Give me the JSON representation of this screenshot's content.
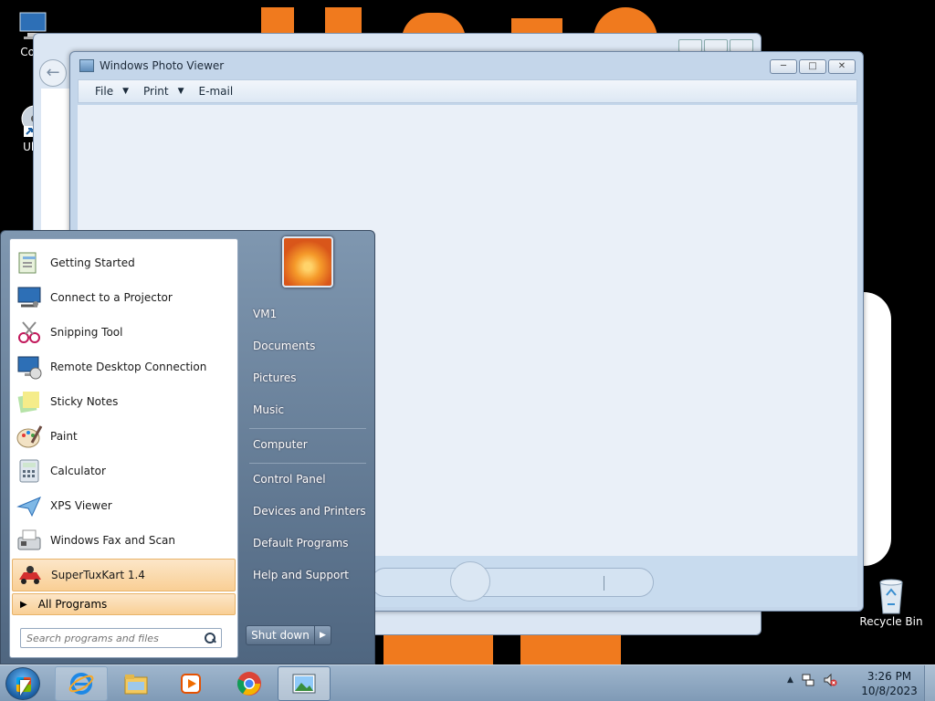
{
  "desktop": {
    "icons": [
      {
        "label": "Com",
        "icon": "computer-icon"
      },
      {
        "label": "Ultr",
        "icon": "disc-shortcut-icon"
      },
      {
        "label": "Recycle Bin",
        "icon": "recycle-bin-icon"
      }
    ]
  },
  "photo_viewer": {
    "title": "Windows Photo Viewer",
    "menu": [
      "File",
      "Print",
      "E-mail"
    ]
  },
  "start_menu": {
    "programs": [
      {
        "label": "Getting Started",
        "icon": "getting-started-icon"
      },
      {
        "label": "Connect to a Projector",
        "icon": "projector-icon"
      },
      {
        "label": "Snipping Tool",
        "icon": "scissors-icon"
      },
      {
        "label": "Remote Desktop Connection",
        "icon": "remote-desktop-icon"
      },
      {
        "label": "Sticky Notes",
        "icon": "sticky-notes-icon"
      },
      {
        "label": "Paint",
        "icon": "paint-palette-icon"
      },
      {
        "label": "Calculator",
        "icon": "calculator-icon"
      },
      {
        "label": "XPS Viewer",
        "icon": "xps-viewer-icon"
      },
      {
        "label": "Windows Fax and Scan",
        "icon": "fax-icon"
      },
      {
        "label": "SuperTuxKart 1.4",
        "icon": "kart-icon"
      }
    ],
    "all_programs": "All Programs",
    "search_placeholder": "Search programs and files",
    "right_links": [
      "VM1",
      "Documents",
      "Pictures",
      "Music",
      "Computer",
      "Control Panel",
      "Devices and Printers",
      "Default Programs",
      "Help and Support"
    ],
    "shutdown": "Shut down"
  },
  "taskbar": {
    "pinned": [
      "internet-explorer-icon",
      "file-explorer-icon",
      "media-player-icon",
      "chrome-icon",
      "photo-viewer-icon"
    ],
    "time": "3:26 PM",
    "date": "10/8/2023"
  }
}
